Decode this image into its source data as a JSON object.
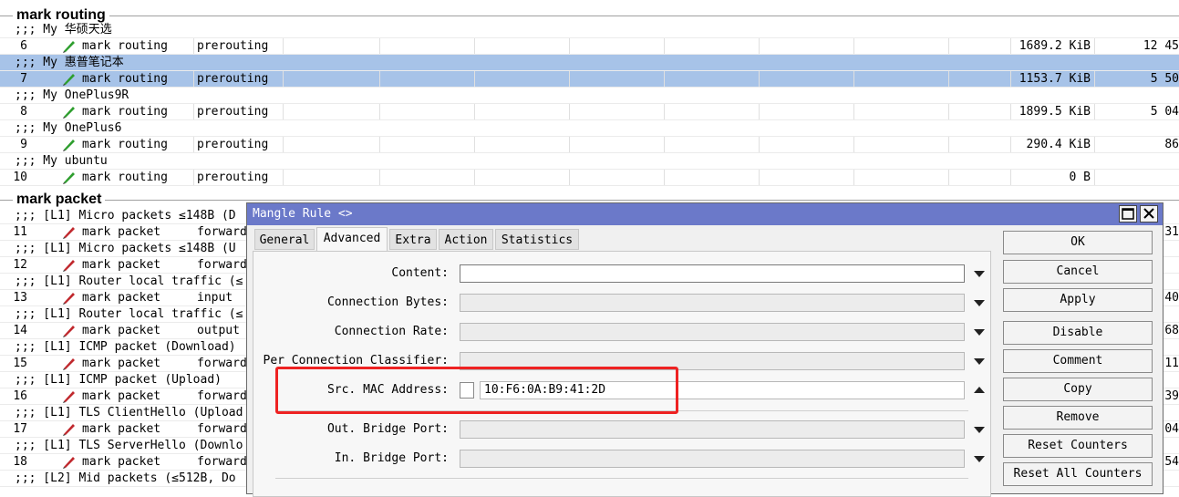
{
  "sections": {
    "routing_title": "mark routing",
    "packet_title": "mark packet"
  },
  "routing_rows": [
    {
      "comment": ";;; My 华硕天选",
      "num": "6",
      "action": "mark routing",
      "chain": "prerouting",
      "bytes": "1689.2 KiB",
      "packets": "12 45",
      "selected": false
    },
    {
      "comment": ";;; My 惠普笔记本",
      "num": "7",
      "action": "mark routing",
      "chain": "prerouting",
      "bytes": "1153.7 KiB",
      "packets": "5 50",
      "selected": true
    },
    {
      "comment": ";;; My OnePlus9R",
      "num": "8",
      "action": "mark routing",
      "chain": "prerouting",
      "bytes": "1899.5 KiB",
      "packets": "5 04",
      "selected": false
    },
    {
      "comment": ";;; My OnePlus6",
      "num": "9",
      "action": "mark routing",
      "chain": "prerouting",
      "bytes": "290.4 KiB",
      "packets": "86",
      "selected": false
    },
    {
      "comment": ";;; My ubuntu",
      "num": "10",
      "action": "mark routing",
      "chain": "prerouting",
      "bytes": "0 B",
      "packets": "",
      "selected": false
    }
  ],
  "packet_rows": [
    {
      "comment": ";;; [L1] Micro packets ≤148B (D",
      "num": "11",
      "action": "mark packet",
      "chain": "forward",
      "right": "31"
    },
    {
      "comment": ";;; [L1] Micro packets ≤148B (U",
      "num": "12",
      "action": "mark packet",
      "chain": "forward",
      "right": ""
    },
    {
      "comment": ";;; [L1] Router local traffic (≤",
      "num": "13",
      "action": "mark packet",
      "chain": "input",
      "right": "40"
    },
    {
      "comment": ";;; [L1] Router local traffic (≤",
      "num": "14",
      "action": "mark packet",
      "chain": "output",
      "right": "68"
    },
    {
      "comment": ";;; [L1] ICMP packet (Download)",
      "num": "15",
      "action": "mark packet",
      "chain": "forward",
      "right": "11"
    },
    {
      "comment": ";;; [L1] ICMP packet (Upload)",
      "num": "16",
      "action": "mark packet",
      "chain": "forward",
      "right": "39"
    },
    {
      "comment": ";;; [L1] TLS ClientHello (Upload",
      "num": "17",
      "action": "mark packet",
      "chain": "forward",
      "right": "04"
    },
    {
      "comment": ";;; [L1] TLS ServerHello (Downlo",
      "num": "18",
      "action": "mark packet",
      "chain": "forward",
      "right": "54"
    },
    {
      "comment": ";;; [L2] Mid packets (≤512B, Do",
      "num": "",
      "action": "",
      "chain": "",
      "right": ""
    }
  ],
  "dialog": {
    "title": "Mangle Rule <>",
    "tabs": [
      "General",
      "Advanced",
      "Extra",
      "Action",
      "Statistics"
    ],
    "active_tab": "Advanced",
    "fields": {
      "content": {
        "label": "Content:",
        "value": ""
      },
      "connection_bytes": {
        "label": "Connection Bytes:",
        "value": ""
      },
      "connection_rate": {
        "label": "Connection Rate:",
        "value": ""
      },
      "per_connection_classifier": {
        "label": "Per Connection Classifier:",
        "value": ""
      },
      "src_mac_address": {
        "label": "Src. MAC Address:",
        "value": "10:F6:0A:B9:41:2D"
      },
      "out_bridge_port": {
        "label": "Out. Bridge Port:",
        "value": ""
      },
      "in_bridge_port": {
        "label": "In. Bridge Port:",
        "value": ""
      }
    },
    "buttons": {
      "ok": "OK",
      "cancel": "Cancel",
      "apply": "Apply",
      "disable": "Disable",
      "comment": "Comment",
      "copy": "Copy",
      "remove": "Remove",
      "reset_counters": "Reset Counters",
      "reset_all_counters": "Reset All Counters"
    }
  },
  "colors": {
    "selected_row": "#a7c3e8",
    "titlebar": "#6b79c9",
    "highlight": "#e22222",
    "routing_icon": "#2e9e2e",
    "packet_icon": "#c0282d"
  },
  "icons": {
    "routing": "green-pencil-icon",
    "packet": "red-pencil-icon",
    "maximize": "maximize-icon",
    "close": "close-icon"
  }
}
